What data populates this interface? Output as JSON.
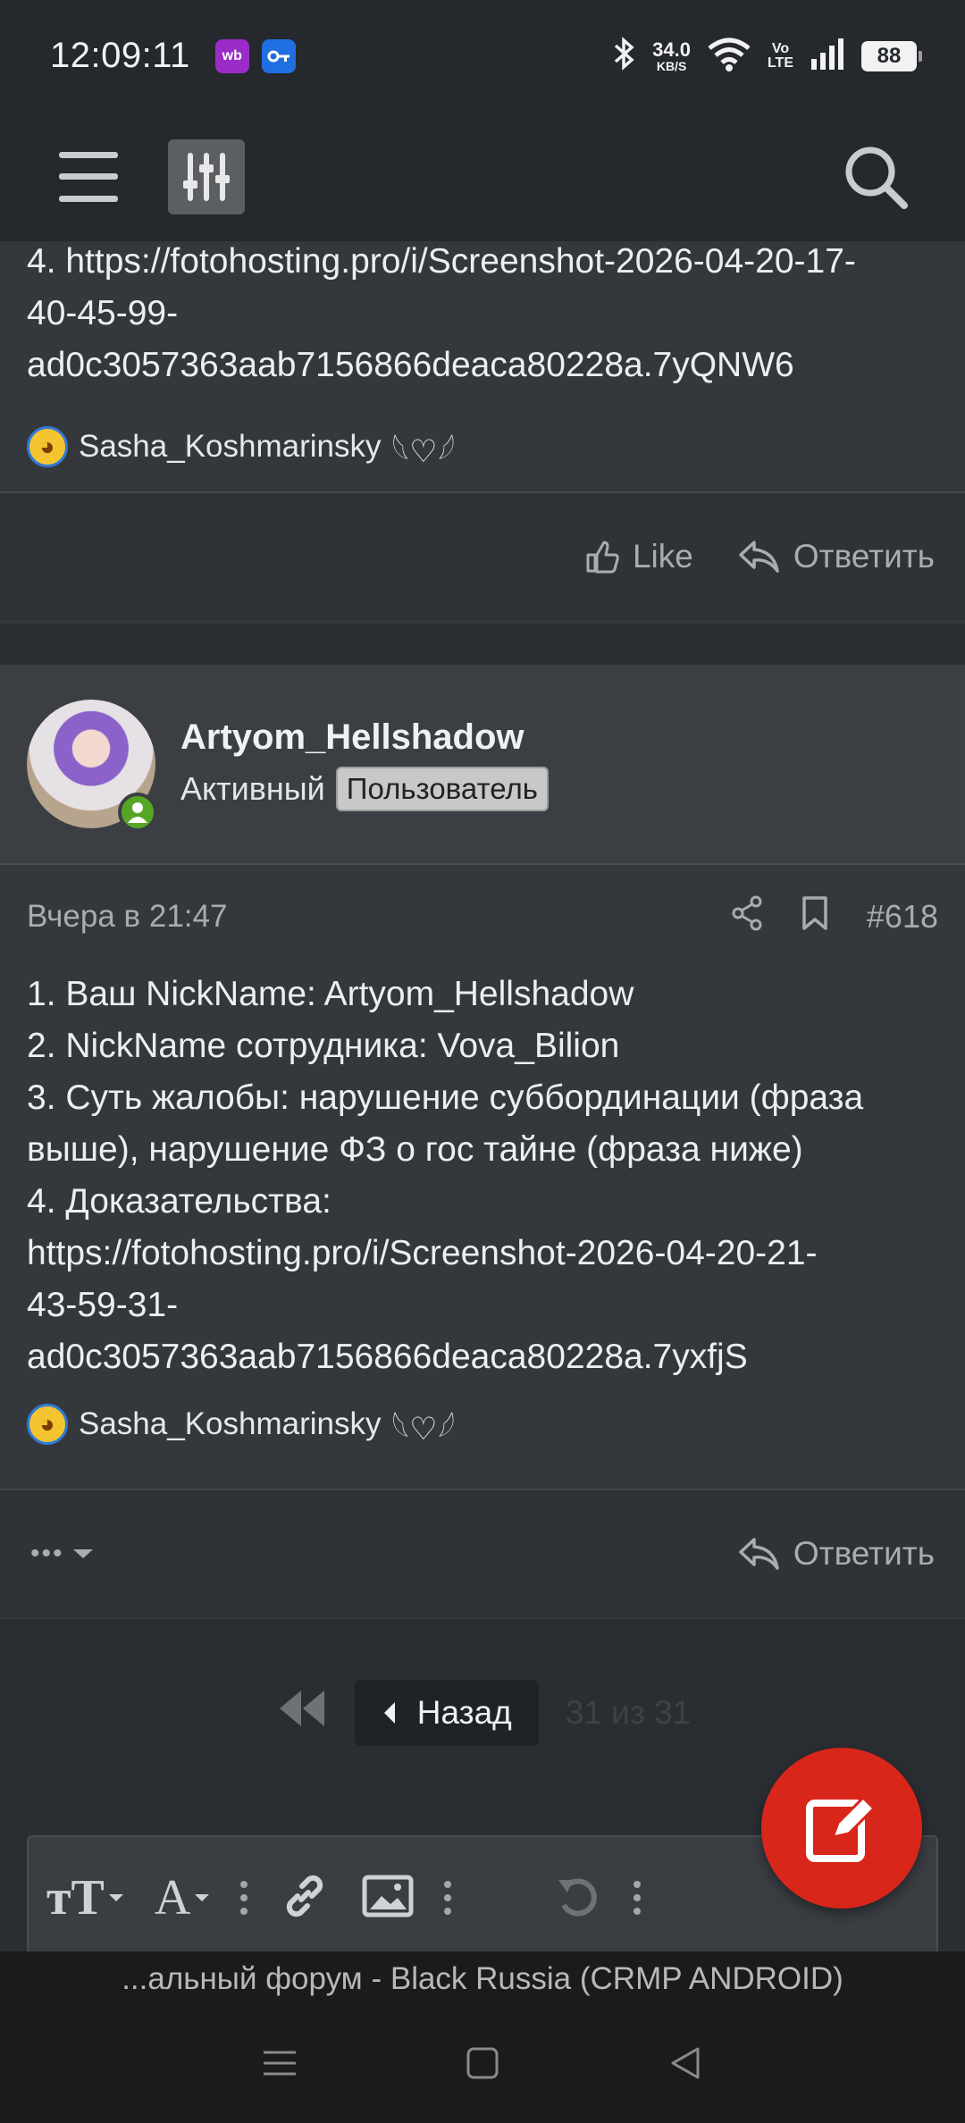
{
  "status_bar": {
    "time": "12:09:11",
    "app_icons": [
      "wb",
      "key"
    ],
    "speed_value": "34.0",
    "speed_unit": "KB/S",
    "volte_top": "Vo",
    "volte_bottom": "LTE",
    "battery": "88"
  },
  "posts": [
    {
      "text_lines": [
        "4. https://fotohosting.pro/i/Screenshot-2026-04-20-17-",
        "40-45-99-",
        "ad0c3057363aab7156866deaca80228a.7yQNW6"
      ],
      "signature_name": "Sasha_Koshmarinsky",
      "signature_suffix": "𓆩♡𓆪",
      "actions": {
        "like": "Like",
        "reply": "Ответить"
      }
    },
    {
      "author": "Artyom_Hellshadow",
      "status": "Активный",
      "role_badge": "Пользователь",
      "date": "Вчера в 21:47",
      "post_number": "#618",
      "text_lines": [
        "1. Ваш NickName: Artyom_Hellshadow",
        "2. NickName сотрудника: Vova_Bilion",
        "3. Суть жалобы: нарушение суббординации (фраза",
        "выше), нарушение ФЗ о гос тайне (фраза ниже)",
        "4. Доказательства:",
        "https://fotohosting.pro/i/Screenshot-2026-04-20-21-",
        "43-59-31-",
        "ad0c3057363aab7156866deaca80228a.7yxfjS"
      ],
      "signature_name": "Sasha_Koshmarinsky",
      "signature_suffix": "𓆩♡𓆪",
      "actions": {
        "more": "•••",
        "reply": "Ответить"
      }
    }
  ],
  "pager": {
    "back_label": "Назад",
    "count": "31 из 31"
  },
  "browser_title": "...альный форум - Black Russia (CRMP ANDROID)"
}
